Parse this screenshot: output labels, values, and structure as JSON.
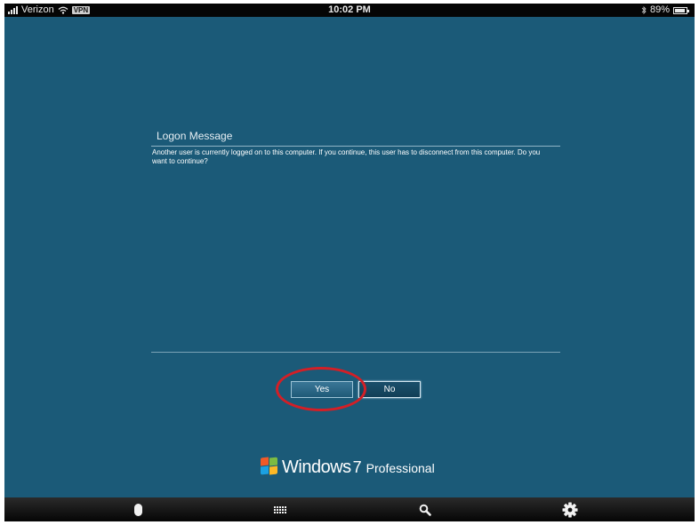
{
  "status_bar": {
    "carrier": "Verizon",
    "vpn_badge": "VPN",
    "time": "10:02 PM",
    "battery": "89%",
    "battery_level": 0.89
  },
  "dialog": {
    "title": "Logon Message",
    "message": "Another user is currently logged on to this computer. If you continue, this user has to disconnect from this computer. Do you want to continue?",
    "yes_label": "Yes",
    "no_label": "No"
  },
  "branding": {
    "name": "Windows",
    "version": "7",
    "edition": "Professional"
  },
  "toolbar": {
    "items": [
      "mouse-icon",
      "keyboard-icon",
      "search-icon",
      "gear-icon"
    ]
  },
  "colors": {
    "background": "#1b5a78",
    "annotation": "#d31f26"
  }
}
